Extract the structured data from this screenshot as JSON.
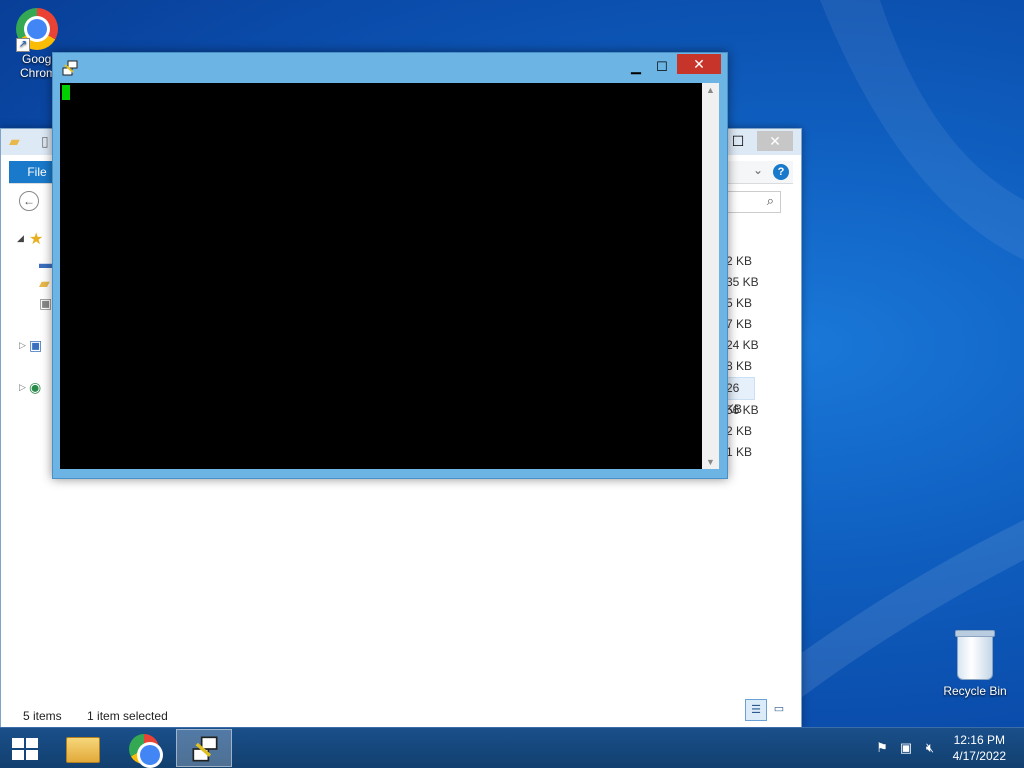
{
  "desktop": {
    "chrome_icon_label_line1": "Googl",
    "chrome_icon_label_line2": "Chrom",
    "recycle_bin_label": "Recycle Bin"
  },
  "explorer": {
    "file_tab_label": "File",
    "close_glyph": "✕",
    "maximize_glyph": "☐",
    "search_glyph": "⌕",
    "help_glyph": "?",
    "file_sizes": [
      "2 KB",
      "35 KB",
      "5 KB",
      "7 KB",
      "24 KB",
      "8 KB",
      "26 KB",
      "56 KB",
      "2 KB",
      "1 KB"
    ],
    "selected_index": 6,
    "status_items": "5 items",
    "status_selected": "1 item selected"
  },
  "terminal": {
    "minimize_glyph": "▁",
    "maximize_glyph": "☐",
    "close_glyph": "✕",
    "cursor_color": "#00d000"
  },
  "taskbar": {
    "clock_time": "12:16 PM",
    "clock_date": "4/17/2022",
    "items": [
      "start-button",
      "file-explorer",
      "google-chrome",
      "putty-terminal"
    ],
    "active_item": "putty-terminal"
  },
  "colors": {
    "desktop_blue": "#0f5fc0",
    "window_frame": "#6cb4e4",
    "close_red": "#c7342a",
    "file_tab_blue": "#1979ca"
  }
}
